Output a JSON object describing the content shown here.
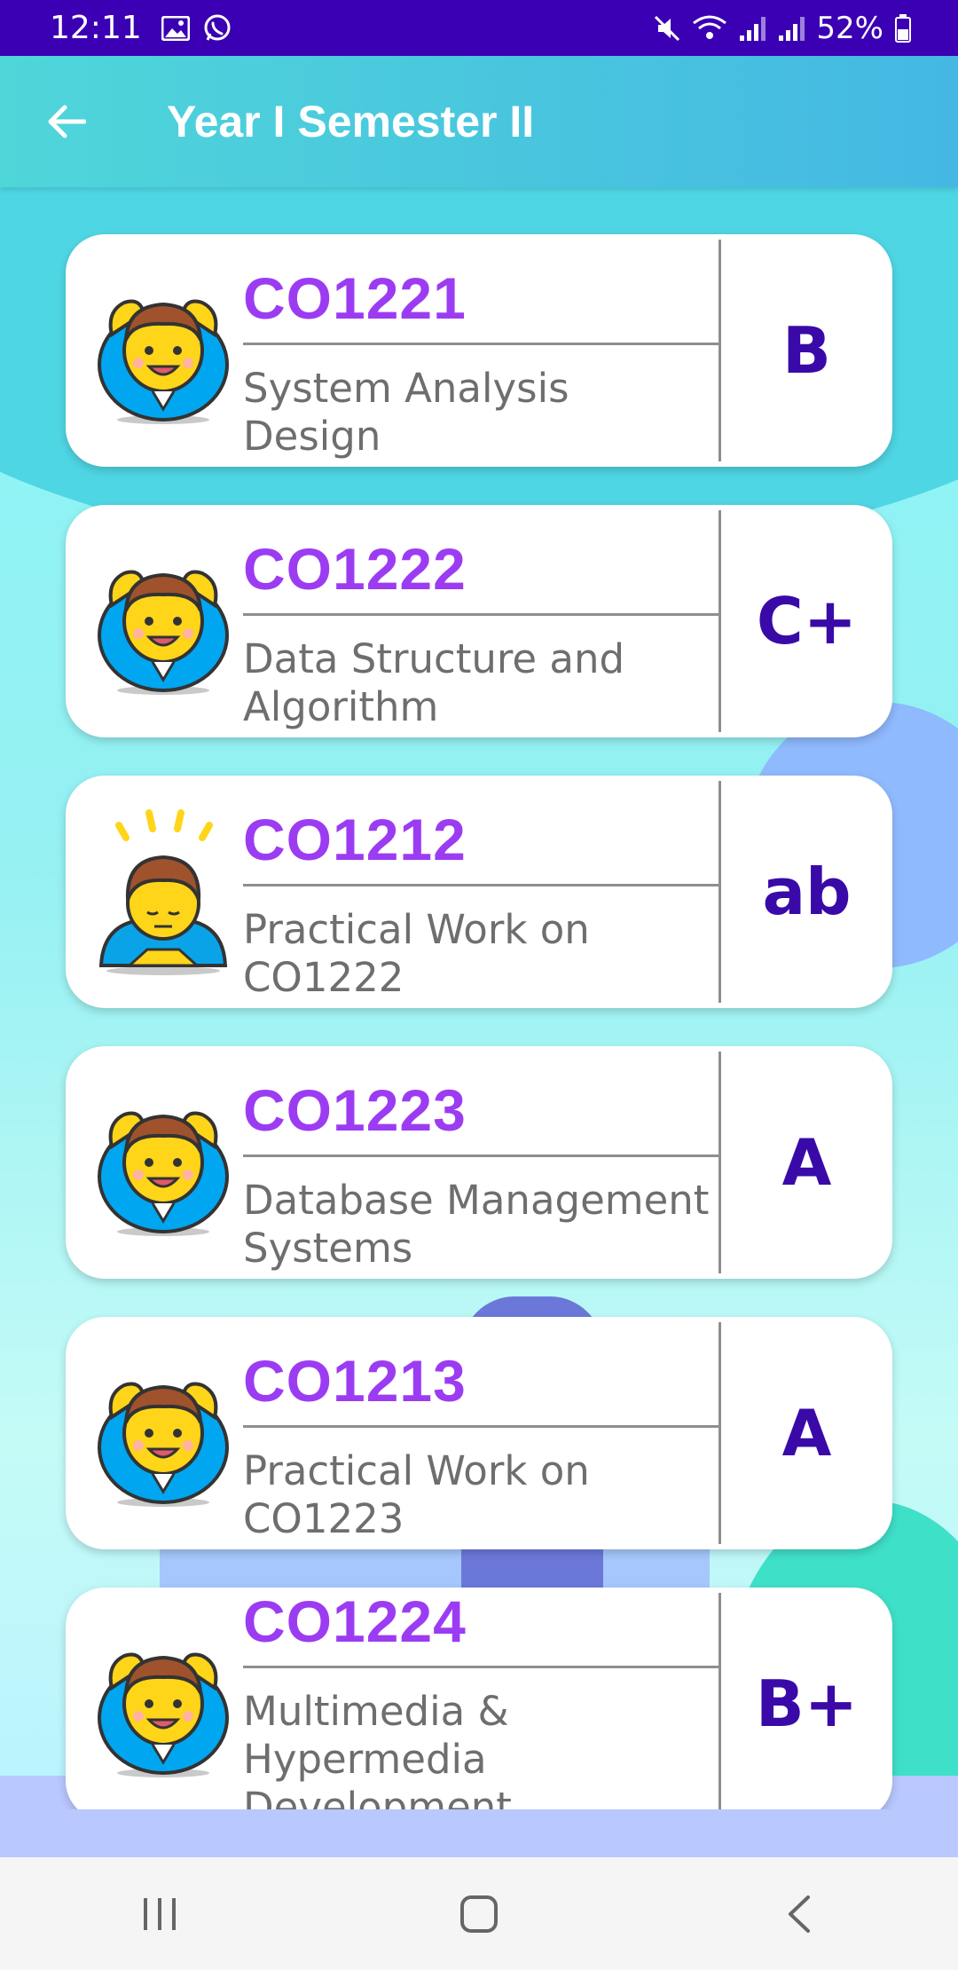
{
  "status_bar": {
    "time": "12:11",
    "battery": "52%"
  },
  "app_bar": {
    "title": "Year I Semester II"
  },
  "courses": [
    {
      "code": "CO1221",
      "title": "System Analysis Design",
      "grade": "B",
      "avatar": "man-gesturing-ok-icon"
    },
    {
      "code": "CO1222",
      "title": "Data Structure and\nAlgorithm",
      "grade": "C+",
      "avatar": "man-gesturing-ok-icon"
    },
    {
      "code": "CO1212",
      "title": "Practical Work on CO1222",
      "grade": "ab",
      "avatar": "man-bowing-icon"
    },
    {
      "code": "CO1223",
      "title": "Database Management\nSystems",
      "grade": "A",
      "avatar": "man-gesturing-ok-icon"
    },
    {
      "code": "CO1213",
      "title": "Practical Work on CO1223",
      "grade": "A",
      "avatar": "man-gesturing-ok-icon"
    },
    {
      "code": "CO1224",
      "title": "Multimedia & Hypermedia\nDevelopment",
      "grade": "B+",
      "avatar": "man-gesturing-ok-icon"
    }
  ],
  "colors": {
    "status_bar": "#3b00b3",
    "course_code": "#9c3cf2",
    "grade": "#3a0aa8",
    "title_text": "#6e6e6e"
  }
}
